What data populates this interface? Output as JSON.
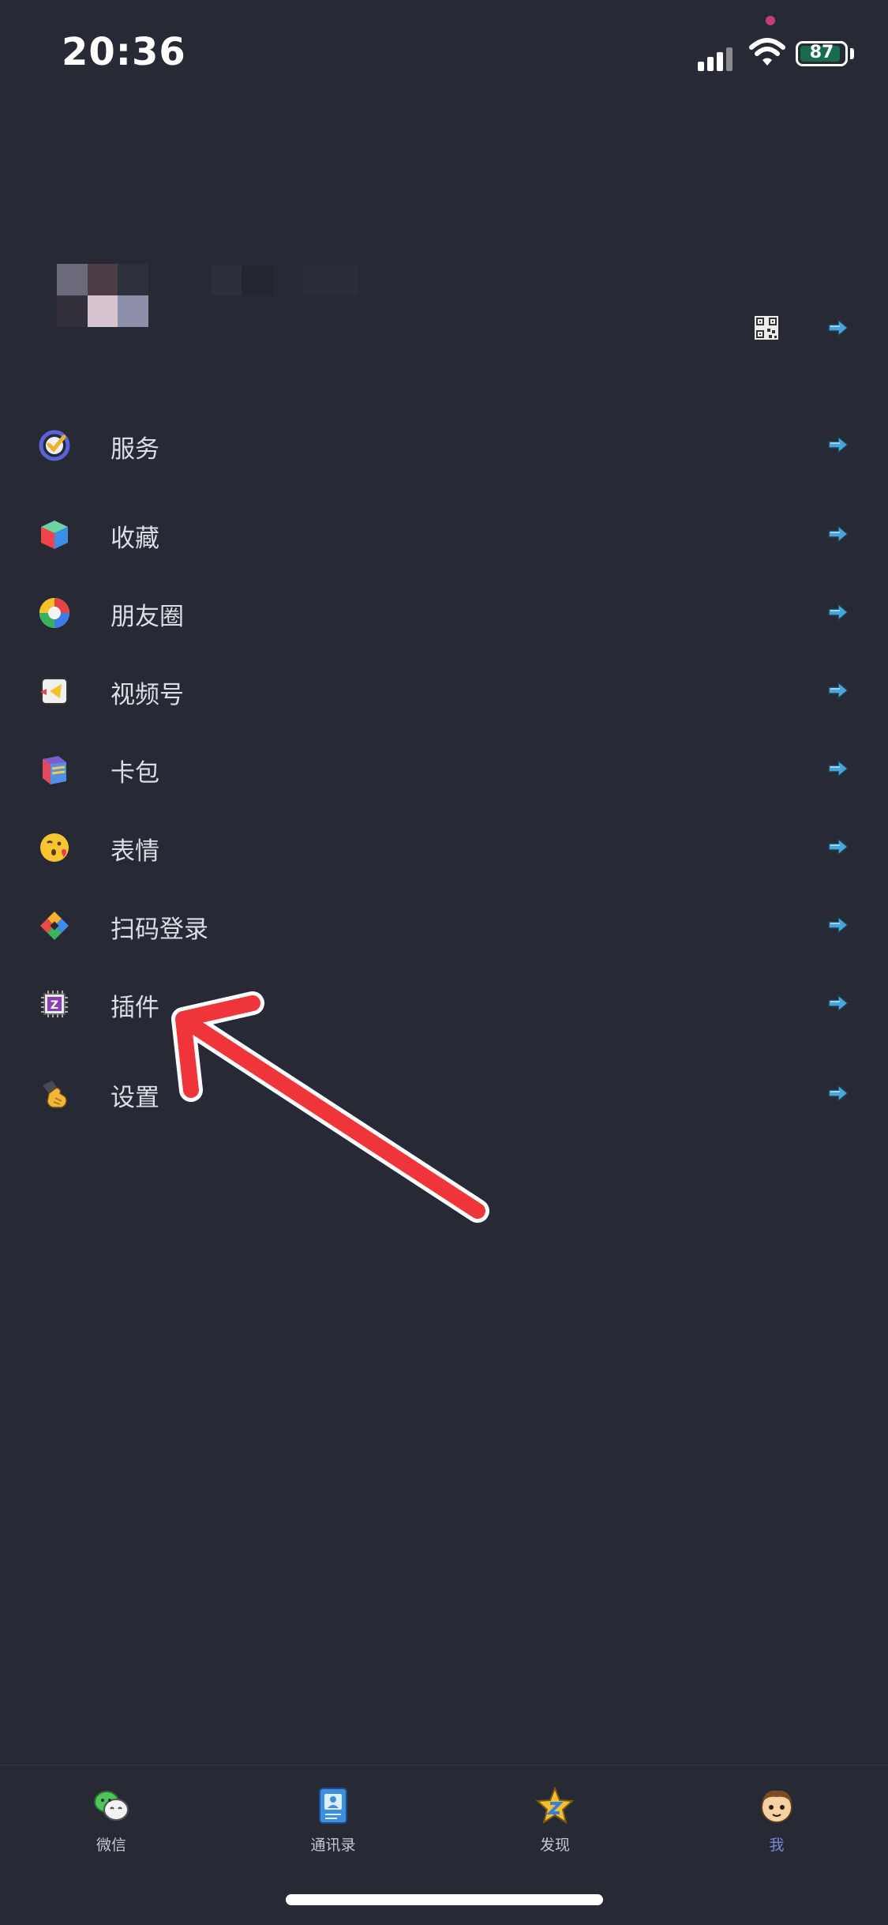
{
  "status_bar": {
    "time": "20:36",
    "battery": "87"
  },
  "menu": {
    "items": [
      {
        "label": "服务",
        "icon": "service-icon"
      },
      {
        "label": "收藏",
        "icon": "favorites-cube-icon"
      },
      {
        "label": "朋友圈",
        "icon": "moments-icon"
      },
      {
        "label": "视频号",
        "icon": "channels-icon"
      },
      {
        "label": "卡包",
        "icon": "card-wallet-icon"
      },
      {
        "label": "表情",
        "icon": "sticker-emoji-icon"
      },
      {
        "label": "扫码登录",
        "icon": "scan-login-icon"
      },
      {
        "label": "插件",
        "icon": "plugin-chip-icon"
      },
      {
        "label": "设置",
        "icon": "settings-hand-icon"
      }
    ]
  },
  "tab_bar": {
    "tabs": [
      {
        "label": "微信",
        "icon": "chats-bubble-icon"
      },
      {
        "label": "通讯录",
        "icon": "contacts-book-icon"
      },
      {
        "label": "发现",
        "icon": "discover-star-icon"
      },
      {
        "label": "我",
        "icon": "me-avatar-icon",
        "active": true
      }
    ]
  },
  "colors": {
    "background": "#272a35",
    "accent": "#7d86d6",
    "annotation": "#f0353a",
    "chevron": "#4aa6d8"
  }
}
